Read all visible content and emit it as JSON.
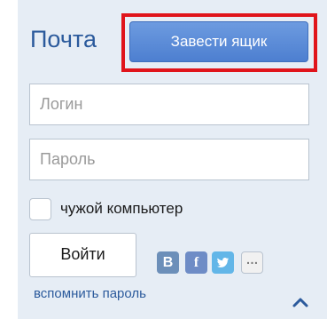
{
  "mail": {
    "title": "Почта",
    "create_button": "Завести ящик"
  },
  "form": {
    "login_placeholder": "Логин",
    "password_placeholder": "Пароль",
    "checkbox_label": "чужой компьютер",
    "login_button": "Войти",
    "forgot_link": "вспомнить пароль"
  },
  "social": {
    "vk_glyph": "B",
    "fb_glyph": "f",
    "more_glyph": "…"
  },
  "colors": {
    "accent": "#2b5a9c",
    "button": "#5a8bd8",
    "highlight": "#e0141b",
    "panel": "#e6edf5"
  }
}
